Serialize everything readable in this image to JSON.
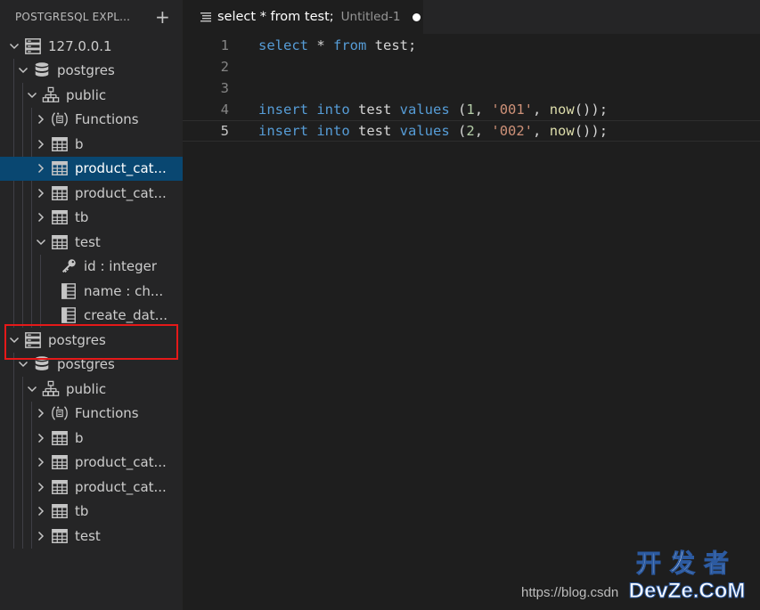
{
  "sidebar": {
    "title": "POSTGRESQL EXPL...",
    "add_label": "+",
    "tree": [
      {
        "level": 0,
        "expanded": true,
        "icon": "server-icon",
        "label": "127.0.0.1"
      },
      {
        "level": 1,
        "expanded": true,
        "icon": "database-icon",
        "label": "postgres"
      },
      {
        "level": 2,
        "expanded": true,
        "icon": "schema-icon",
        "label": "public"
      },
      {
        "level": 3,
        "expanded": false,
        "icon": "functions-icon",
        "label": "Functions"
      },
      {
        "level": 3,
        "expanded": false,
        "icon": "table-icon",
        "label": "b"
      },
      {
        "level": 3,
        "expanded": false,
        "icon": "table-icon",
        "label": "product_cat...",
        "selected": true
      },
      {
        "level": 3,
        "expanded": false,
        "icon": "table-icon",
        "label": "product_cat..."
      },
      {
        "level": 3,
        "expanded": false,
        "icon": "table-icon",
        "label": "tb"
      },
      {
        "level": 3,
        "expanded": true,
        "icon": "table-icon",
        "label": "test"
      },
      {
        "level": 4,
        "icon": "key-icon",
        "label": "id : integer"
      },
      {
        "level": 4,
        "icon": "column-icon",
        "label": "name : ch..."
      },
      {
        "level": 4,
        "icon": "column-icon",
        "label": "create_dat..."
      },
      {
        "level": 0,
        "expanded": true,
        "icon": "server-icon",
        "label": "postgres"
      },
      {
        "level": 1,
        "expanded": true,
        "icon": "database-icon",
        "label": "postgres"
      },
      {
        "level": 2,
        "expanded": true,
        "icon": "schema-icon",
        "label": "public"
      },
      {
        "level": 3,
        "expanded": false,
        "icon": "functions-icon",
        "label": "Functions"
      },
      {
        "level": 3,
        "expanded": false,
        "icon": "table-icon",
        "label": "b"
      },
      {
        "level": 3,
        "expanded": false,
        "icon": "table-icon",
        "label": "product_cat..."
      },
      {
        "level": 3,
        "expanded": false,
        "icon": "table-icon",
        "label": "product_cat..."
      },
      {
        "level": 3,
        "expanded": false,
        "icon": "table-icon",
        "label": "tb"
      },
      {
        "level": 3,
        "expanded": false,
        "icon": "table-icon",
        "label": "test"
      }
    ]
  },
  "tab": {
    "title": "select * from test;",
    "description": "Untitled-1",
    "dirty": true
  },
  "editor": {
    "current_line": 5,
    "lines": [
      {
        "n": "1",
        "tokens": [
          [
            "kw",
            "select"
          ],
          [
            "op",
            " * "
          ],
          [
            "kw",
            "from"
          ],
          [
            "id",
            " test;"
          ]
        ]
      },
      {
        "n": "2",
        "tokens": []
      },
      {
        "n": "3",
        "tokens": []
      },
      {
        "n": "4",
        "tokens": [
          [
            "kw",
            "insert"
          ],
          [
            "op",
            " "
          ],
          [
            "kw",
            "into"
          ],
          [
            "id",
            " test "
          ],
          [
            "kw",
            "values"
          ],
          [
            "op",
            " ("
          ],
          [
            "num",
            "1"
          ],
          [
            "op",
            ", "
          ],
          [
            "str",
            "'001'"
          ],
          [
            "op",
            ", "
          ],
          [
            "fn",
            "now"
          ],
          [
            "op",
            "());"
          ]
        ]
      },
      {
        "n": "5",
        "tokens": [
          [
            "kw",
            "insert"
          ],
          [
            "op",
            " "
          ],
          [
            "kw",
            "into"
          ],
          [
            "id",
            " test "
          ],
          [
            "kw",
            "values"
          ],
          [
            "op",
            " ("
          ],
          [
            "num",
            "2"
          ],
          [
            "op",
            ", "
          ],
          [
            "str",
            "'002'"
          ],
          [
            "op",
            ", "
          ],
          [
            "fn",
            "now"
          ],
          [
            "op",
            "());"
          ]
        ]
      }
    ]
  },
  "watermark": {
    "url": "https://blog.csdn",
    "logo_cn": "开发者",
    "logo_en": "DevZe.CoM"
  },
  "colors": {
    "selection": "#094771",
    "highlight_box": "#e51919",
    "keyword": "#569cd6",
    "string": "#ce9178",
    "number": "#b5cea8",
    "function": "#dcdcaa"
  }
}
